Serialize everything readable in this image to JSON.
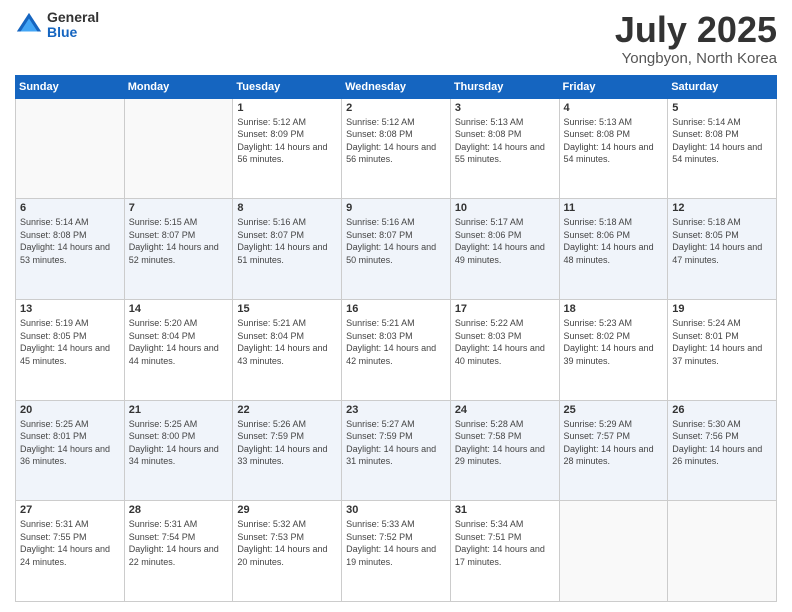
{
  "logo": {
    "general": "General",
    "blue": "Blue"
  },
  "header": {
    "month": "July 2025",
    "location": "Yongbyon, North Korea"
  },
  "weekdays": [
    "Sunday",
    "Monday",
    "Tuesday",
    "Wednesday",
    "Thursday",
    "Friday",
    "Saturday"
  ],
  "weeks": [
    [
      {
        "day": "",
        "sunrise": "",
        "sunset": "",
        "daylight": ""
      },
      {
        "day": "",
        "sunrise": "",
        "sunset": "",
        "daylight": ""
      },
      {
        "day": "1",
        "sunrise": "Sunrise: 5:12 AM",
        "sunset": "Sunset: 8:09 PM",
        "daylight": "Daylight: 14 hours and 56 minutes."
      },
      {
        "day": "2",
        "sunrise": "Sunrise: 5:12 AM",
        "sunset": "Sunset: 8:08 PM",
        "daylight": "Daylight: 14 hours and 56 minutes."
      },
      {
        "day": "3",
        "sunrise": "Sunrise: 5:13 AM",
        "sunset": "Sunset: 8:08 PM",
        "daylight": "Daylight: 14 hours and 55 minutes."
      },
      {
        "day": "4",
        "sunrise": "Sunrise: 5:13 AM",
        "sunset": "Sunset: 8:08 PM",
        "daylight": "Daylight: 14 hours and 54 minutes."
      },
      {
        "day": "5",
        "sunrise": "Sunrise: 5:14 AM",
        "sunset": "Sunset: 8:08 PM",
        "daylight": "Daylight: 14 hours and 54 minutes."
      }
    ],
    [
      {
        "day": "6",
        "sunrise": "Sunrise: 5:14 AM",
        "sunset": "Sunset: 8:08 PM",
        "daylight": "Daylight: 14 hours and 53 minutes."
      },
      {
        "day": "7",
        "sunrise": "Sunrise: 5:15 AM",
        "sunset": "Sunset: 8:07 PM",
        "daylight": "Daylight: 14 hours and 52 minutes."
      },
      {
        "day": "8",
        "sunrise": "Sunrise: 5:16 AM",
        "sunset": "Sunset: 8:07 PM",
        "daylight": "Daylight: 14 hours and 51 minutes."
      },
      {
        "day": "9",
        "sunrise": "Sunrise: 5:16 AM",
        "sunset": "Sunset: 8:07 PM",
        "daylight": "Daylight: 14 hours and 50 minutes."
      },
      {
        "day": "10",
        "sunrise": "Sunrise: 5:17 AM",
        "sunset": "Sunset: 8:06 PM",
        "daylight": "Daylight: 14 hours and 49 minutes."
      },
      {
        "day": "11",
        "sunrise": "Sunrise: 5:18 AM",
        "sunset": "Sunset: 8:06 PM",
        "daylight": "Daylight: 14 hours and 48 minutes."
      },
      {
        "day": "12",
        "sunrise": "Sunrise: 5:18 AM",
        "sunset": "Sunset: 8:05 PM",
        "daylight": "Daylight: 14 hours and 47 minutes."
      }
    ],
    [
      {
        "day": "13",
        "sunrise": "Sunrise: 5:19 AM",
        "sunset": "Sunset: 8:05 PM",
        "daylight": "Daylight: 14 hours and 45 minutes."
      },
      {
        "day": "14",
        "sunrise": "Sunrise: 5:20 AM",
        "sunset": "Sunset: 8:04 PM",
        "daylight": "Daylight: 14 hours and 44 minutes."
      },
      {
        "day": "15",
        "sunrise": "Sunrise: 5:21 AM",
        "sunset": "Sunset: 8:04 PM",
        "daylight": "Daylight: 14 hours and 43 minutes."
      },
      {
        "day": "16",
        "sunrise": "Sunrise: 5:21 AM",
        "sunset": "Sunset: 8:03 PM",
        "daylight": "Daylight: 14 hours and 42 minutes."
      },
      {
        "day": "17",
        "sunrise": "Sunrise: 5:22 AM",
        "sunset": "Sunset: 8:03 PM",
        "daylight": "Daylight: 14 hours and 40 minutes."
      },
      {
        "day": "18",
        "sunrise": "Sunrise: 5:23 AM",
        "sunset": "Sunset: 8:02 PM",
        "daylight": "Daylight: 14 hours and 39 minutes."
      },
      {
        "day": "19",
        "sunrise": "Sunrise: 5:24 AM",
        "sunset": "Sunset: 8:01 PM",
        "daylight": "Daylight: 14 hours and 37 minutes."
      }
    ],
    [
      {
        "day": "20",
        "sunrise": "Sunrise: 5:25 AM",
        "sunset": "Sunset: 8:01 PM",
        "daylight": "Daylight: 14 hours and 36 minutes."
      },
      {
        "day": "21",
        "sunrise": "Sunrise: 5:25 AM",
        "sunset": "Sunset: 8:00 PM",
        "daylight": "Daylight: 14 hours and 34 minutes."
      },
      {
        "day": "22",
        "sunrise": "Sunrise: 5:26 AM",
        "sunset": "Sunset: 7:59 PM",
        "daylight": "Daylight: 14 hours and 33 minutes."
      },
      {
        "day": "23",
        "sunrise": "Sunrise: 5:27 AM",
        "sunset": "Sunset: 7:59 PM",
        "daylight": "Daylight: 14 hours and 31 minutes."
      },
      {
        "day": "24",
        "sunrise": "Sunrise: 5:28 AM",
        "sunset": "Sunset: 7:58 PM",
        "daylight": "Daylight: 14 hours and 29 minutes."
      },
      {
        "day": "25",
        "sunrise": "Sunrise: 5:29 AM",
        "sunset": "Sunset: 7:57 PM",
        "daylight": "Daylight: 14 hours and 28 minutes."
      },
      {
        "day": "26",
        "sunrise": "Sunrise: 5:30 AM",
        "sunset": "Sunset: 7:56 PM",
        "daylight": "Daylight: 14 hours and 26 minutes."
      }
    ],
    [
      {
        "day": "27",
        "sunrise": "Sunrise: 5:31 AM",
        "sunset": "Sunset: 7:55 PM",
        "daylight": "Daylight: 14 hours and 24 minutes."
      },
      {
        "day": "28",
        "sunrise": "Sunrise: 5:31 AM",
        "sunset": "Sunset: 7:54 PM",
        "daylight": "Daylight: 14 hours and 22 minutes."
      },
      {
        "day": "29",
        "sunrise": "Sunrise: 5:32 AM",
        "sunset": "Sunset: 7:53 PM",
        "daylight": "Daylight: 14 hours and 20 minutes."
      },
      {
        "day": "30",
        "sunrise": "Sunrise: 5:33 AM",
        "sunset": "Sunset: 7:52 PM",
        "daylight": "Daylight: 14 hours and 19 minutes."
      },
      {
        "day": "31",
        "sunrise": "Sunrise: 5:34 AM",
        "sunset": "Sunset: 7:51 PM",
        "daylight": "Daylight: 14 hours and 17 minutes."
      },
      {
        "day": "",
        "sunrise": "",
        "sunset": "",
        "daylight": ""
      },
      {
        "day": "",
        "sunrise": "",
        "sunset": "",
        "daylight": ""
      }
    ]
  ]
}
